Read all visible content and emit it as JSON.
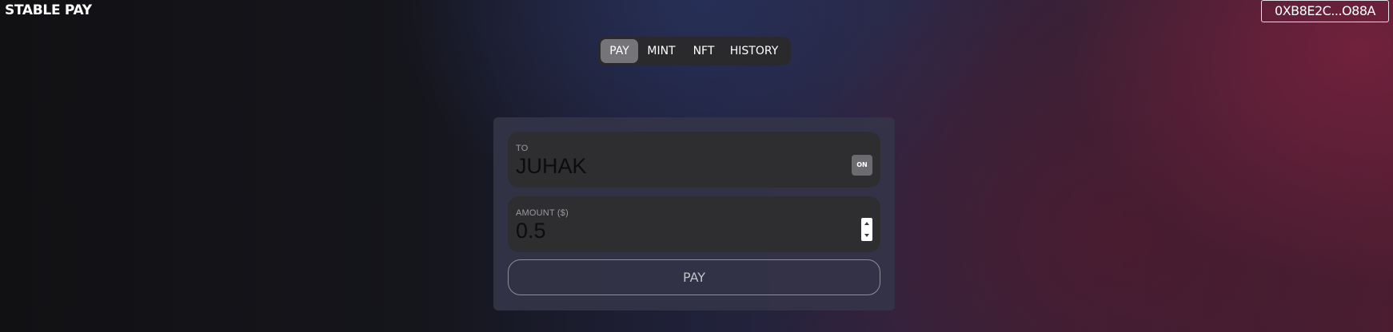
{
  "app": {
    "brand": "STABLE PAY",
    "wallet_address": "0XB8E2C...O88A"
  },
  "tabs": [
    {
      "label": "PAY",
      "active": true
    },
    {
      "label": "MINT",
      "active": false
    },
    {
      "label": "NFT",
      "active": false
    },
    {
      "label": "HISTORY",
      "active": false
    }
  ],
  "form": {
    "to": {
      "label": "TO",
      "value": "JUHAK",
      "toggle_label": "ON"
    },
    "amount": {
      "label": "AMOUNT ($)",
      "value": "0.5"
    },
    "submit_label": "PAY"
  },
  "colors": {
    "active_tab": "#757579",
    "tab_bar": "#2a2a2c",
    "field_bg": "#2e2e30",
    "card_bg": "#343448"
  },
  "icons": {
    "spinner_up": "caret-up-icon",
    "spinner_down": "caret-down-icon"
  }
}
